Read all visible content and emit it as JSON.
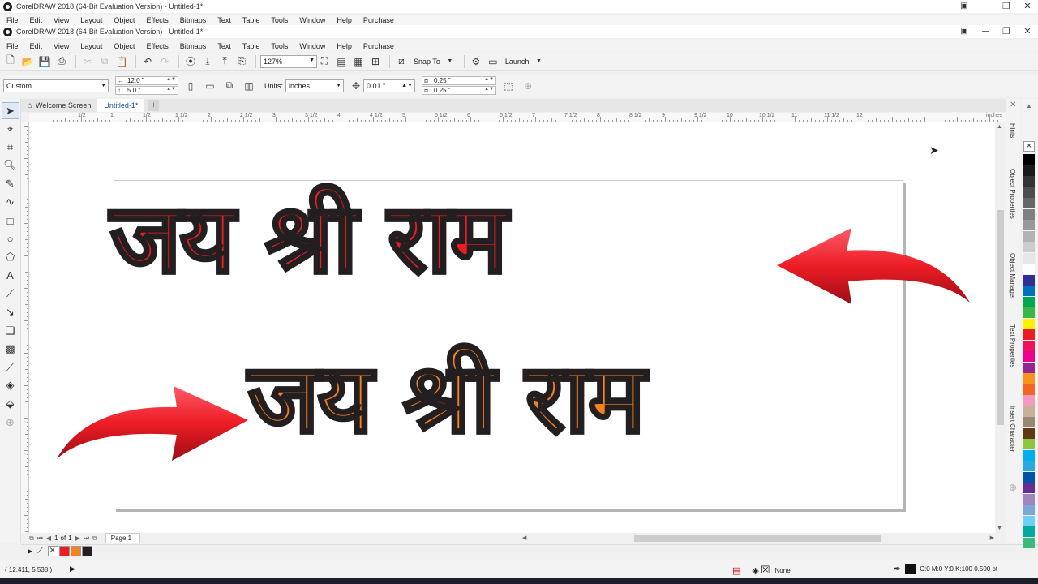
{
  "app": {
    "outer_title": "CorelDRAW 2018 (64-Bit Evaluation Version) - Untitled-1*",
    "inner_title": "CorelDRAW 2018 (64-Bit Evaluation Version) - Untitled-1*"
  },
  "menu": [
    "File",
    "Edit",
    "View",
    "Layout",
    "Object",
    "Effects",
    "Bitmaps",
    "Text",
    "Table",
    "Tools",
    "Window",
    "Help",
    "Purchase"
  ],
  "toolbar": {
    "zoom": "127%",
    "snap_to": "Snap To",
    "launch": "Launch"
  },
  "propbar": {
    "page_preset": "Custom",
    "width": "12.0 \"",
    "height": "5.0 \"",
    "units_label": "Units:",
    "units": "inches",
    "nudge": "0.01 \"",
    "dup_x": "0.25 \"",
    "dup_y": "0.25 \""
  },
  "tabs": {
    "welcome": "Welcome Screen",
    "doc": "Untitled-1*"
  },
  "ruler": {
    "unit": "inches",
    "labels": [
      "1/2",
      "1",
      "1/2",
      "1 1/2",
      "2",
      "2 1/2",
      "3",
      "3 1/2",
      "4",
      "4 1/2",
      "5",
      "5 1/2",
      "6",
      "6 1/2",
      "7",
      "7 1/2",
      "8",
      "8 1/2",
      "9",
      "9 1/2",
      "10",
      "10 1/2",
      "11",
      "11 1/2",
      "12"
    ]
  },
  "artwork": {
    "line1": "जय श्री राम",
    "line2": "जय श्री राम",
    "red": "#ec1c24",
    "orange": "#f58220",
    "outline": "#231f20"
  },
  "pagenav": {
    "current": "1",
    "of_label": "of",
    "total": "1",
    "page_tab": "Page 1"
  },
  "statusbar": {
    "coords": "( 12.411, 5.538 )",
    "fill": "None",
    "outline": "C:0 M:0 Y:0 K:100  0.500 pt"
  },
  "dockers": [
    "Hints",
    "Object Properties",
    "Object Manager",
    "Text Properties",
    "Insert Character"
  ],
  "palette_colors": [
    "#000000",
    "#1a1a1a",
    "#333333",
    "#4d4d4d",
    "#666666",
    "#808080",
    "#999999",
    "#b3b3b3",
    "#cccccc",
    "#e6e6e6",
    "#ffffff",
    "#2e3192",
    "#0072bc",
    "#00a651",
    "#39b54a",
    "#fff200",
    "#ec1c24",
    "#ed145b",
    "#ec008c",
    "#92278f",
    "#f7941d",
    "#f26522",
    "#f49ac1",
    "#c7b299",
    "#998675",
    "#603913",
    "#8dc63f",
    "#00aeef",
    "#29abe2",
    "#0054a6",
    "#662d91",
    "#a186be",
    "#7da7d9",
    "#6dcff6",
    "#00a99d",
    "#3cb878"
  ],
  "doc_palette": [
    "#ec1c24",
    "#f58220",
    "#231f20"
  ]
}
